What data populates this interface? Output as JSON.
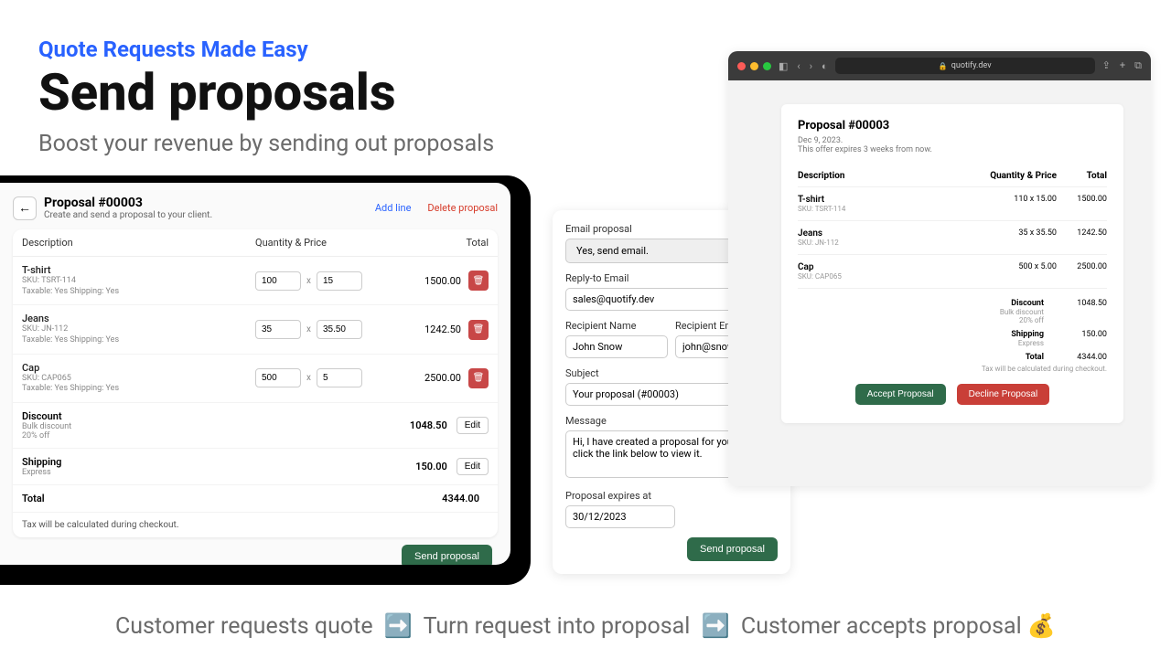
{
  "hero": {
    "eyebrow": "Quote Requests Made Easy",
    "heading": "Send proposals",
    "subheading": "Boost your revenue by sending out proposals"
  },
  "editor": {
    "title": "Proposal #00003",
    "subtitle": "Create and send a proposal to your client.",
    "add_line": "Add line",
    "delete_proposal": "Delete proposal",
    "col_desc": "Description",
    "col_qp": "Quantity & Price",
    "col_total": "Total",
    "lines": [
      {
        "name": "T-shirt",
        "sku": "SKU: TSRT-114",
        "tax_ship": "Taxable: Yes    Shipping: Yes",
        "qty": "100",
        "price": "15",
        "total": "1500.00"
      },
      {
        "name": "Jeans",
        "sku": "SKU: JN-112",
        "tax_ship": "Taxable: Yes    Shipping: Yes",
        "qty": "35",
        "price": "35.50",
        "total": "1242.50"
      },
      {
        "name": "Cap",
        "sku": "SKU: CAP065",
        "tax_ship": "Taxable: Yes    Shipping: Yes",
        "qty": "500",
        "price": "5",
        "total": "2500.00"
      }
    ],
    "discount_label": "Discount",
    "discount_sub1": "Bulk discount",
    "discount_sub2": "20% off",
    "discount_val": "1048.50",
    "shipping_label": "Shipping",
    "shipping_sub": "Express",
    "shipping_val": "150.00",
    "total_label": "Total",
    "total_val": "4344.00",
    "edit": "Edit",
    "tax_note": "Tax will be calculated during checkout.",
    "send": "Send proposal"
  },
  "email": {
    "email_proposal_label": "Email proposal",
    "email_proposal_value": "Yes, send email.",
    "reply_label": "Reply-to Email",
    "reply_value": "sales@quotify.dev",
    "recipient_name_label": "Recipient Name",
    "recipient_name_value": "John Snow",
    "recipient_email_label": "Recipient Email",
    "recipient_email_value": "john@snowinc.com",
    "subject_label": "Subject",
    "subject_value": "Your proposal (#00003)",
    "message_label": "Message",
    "message_value": "Hi, I have created a proposal for you. Please click the link below to view it.",
    "expires_label": "Proposal expires at",
    "expires_value": "30/12/2023",
    "send": "Send proposal"
  },
  "browser": {
    "url": "quotify.dev",
    "title": "Proposal #00003",
    "date": "Dec 9, 2023.",
    "expires": "This offer expires 3 weeks from now.",
    "col_desc": "Description",
    "col_qp": "Quantity & Price",
    "col_total": "Total",
    "items": [
      {
        "name": "T-shirt",
        "sku": "SKU: TSRT-114",
        "qp": "110 x 15.00",
        "total": "1500.00"
      },
      {
        "name": "Jeans",
        "sku": "SKU: JN-112",
        "qp": "35 x 35.50",
        "total": "1242.50"
      },
      {
        "name": "Cap",
        "sku": "SKU: CAP065",
        "qp": "500 x 5.00",
        "total": "2500.00"
      }
    ],
    "discount_label": "Discount",
    "discount_sub1": "Bulk discount",
    "discount_sub2": "20% off",
    "discount_val": "1048.50",
    "shipping_label": "Shipping",
    "shipping_sub": "Express",
    "shipping_val": "150.00",
    "total_label": "Total",
    "total_val": "4344.00",
    "tax_note": "Tax will be calculated during checkout.",
    "accept": "Accept Proposal",
    "decline": "Decline Proposal"
  },
  "footer": {
    "step1": "Customer requests quote",
    "step2": "Turn request into proposal",
    "step3": "Customer accepts proposal",
    "arrow": "➡️",
    "money": "💰"
  }
}
